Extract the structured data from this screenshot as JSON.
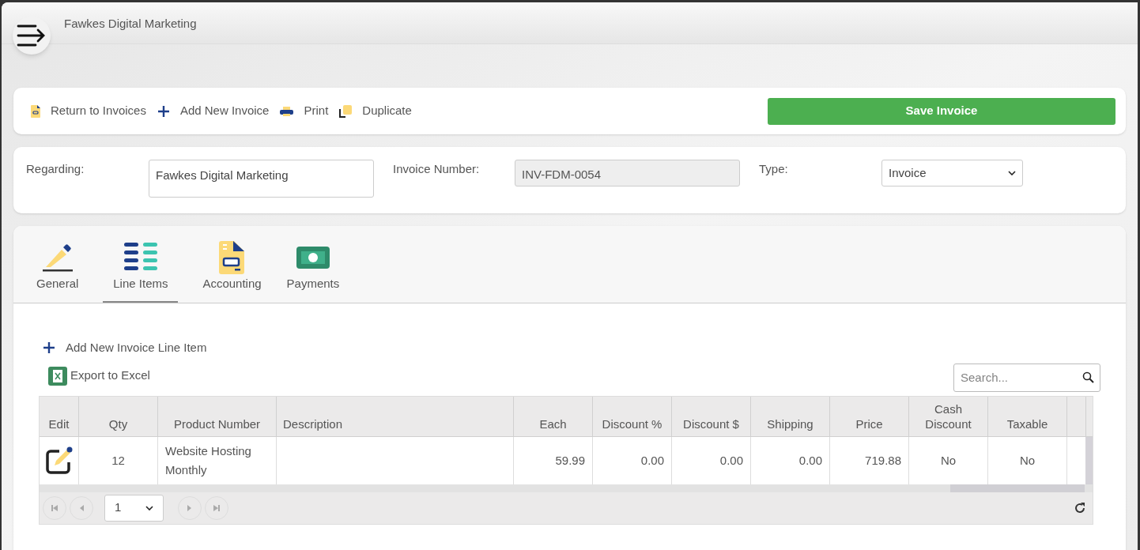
{
  "header": {
    "title": "Fawkes Digital Marketing"
  },
  "toolbar": {
    "actions": [
      {
        "kind": "return",
        "label": "Return to Invoices"
      },
      {
        "kind": "add",
        "label": "Add New Invoice"
      },
      {
        "kind": "print",
        "label": "Print"
      },
      {
        "kind": "duplicate",
        "label": "Duplicate"
      }
    ],
    "save_button": "Save Invoice"
  },
  "form": {
    "regarding": {
      "label": "Regarding:",
      "value": "Fawkes Digital Marketing"
    },
    "invoice_number": {
      "label": "Invoice Number:",
      "value": "INV-FDM-0054",
      "disabled": true
    },
    "type": {
      "label": "Type:",
      "value": "Invoice"
    }
  },
  "tabs": [
    {
      "kind": "general",
      "label": "General",
      "selected": false
    },
    {
      "kind": "lines",
      "label": "Line Items",
      "selected": true
    },
    {
      "kind": "accounting",
      "label": "Accounting",
      "selected": false
    },
    {
      "kind": "payments",
      "label": "Payments",
      "selected": false
    }
  ],
  "add_line_item": "Add New Invoice Line Item",
  "export": "Export to Excel",
  "search": {
    "placeholder": "Search..."
  },
  "table": {
    "columns": [
      "Edit",
      "Qty",
      "Product Number",
      "Description",
      "Each",
      "Discount %",
      "Discount $",
      "Shipping",
      "Price",
      "Cash Discount",
      "Taxable"
    ],
    "rows": [
      {
        "qty": "12",
        "product_number": "Website Hosting Monthly",
        "description": "",
        "each": "59.99",
        "discount_pct": "0.00",
        "discount_amt": "0.00",
        "shipping": "0.00",
        "price": "719.88",
        "cash_discount": "No",
        "taxable": "No"
      }
    ]
  },
  "pager": {
    "page": "1"
  }
}
